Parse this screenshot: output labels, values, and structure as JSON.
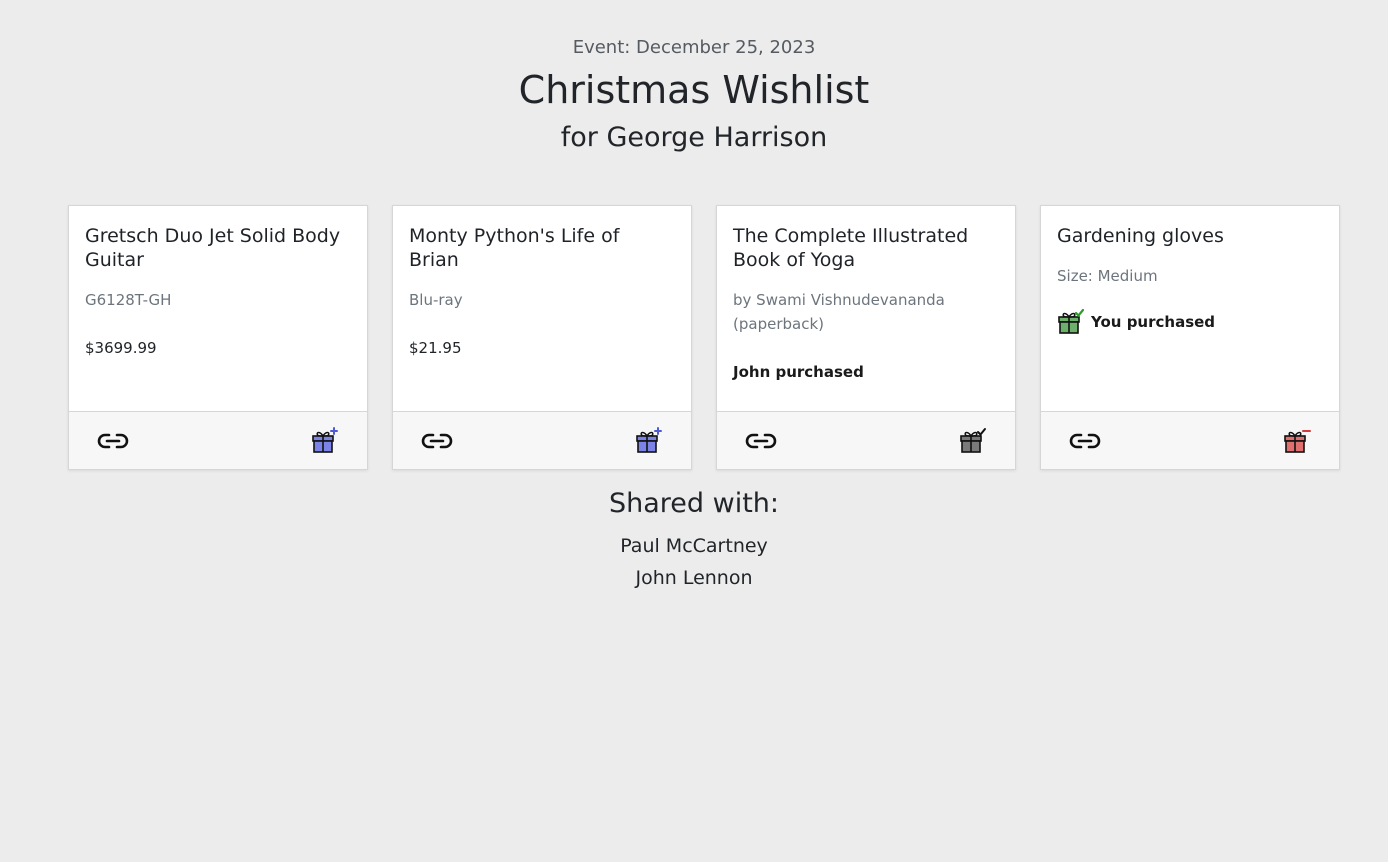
{
  "header": {
    "event_label": "Event: December 25, 2023",
    "title": "Christmas Wishlist",
    "subtitle": "for George Harrison"
  },
  "items": [
    {
      "title": "Gretsch Duo Jet Solid Body Guitar",
      "subtitle": "G6128T-GH",
      "price": "$3699.99",
      "status": "",
      "gift_icon": "gift-add-icon",
      "gift_color": "#7b83e6"
    },
    {
      "title": "Monty Python's Life of Brian",
      "subtitle": "Blu-ray",
      "price": "$21.95",
      "status": "",
      "gift_icon": "gift-add-icon",
      "gift_color": "#7b83e6"
    },
    {
      "title": "The Complete Illustrated Book of Yoga",
      "subtitle": "by Swami Vishnudevananda (paperback)",
      "price": "",
      "status": "John purchased",
      "gift_icon": "gift-purchased-icon",
      "gift_color": "#7a7a7a"
    },
    {
      "title": "Gardening gloves",
      "subtitle": "Size: Medium",
      "price": "",
      "status": "You purchased",
      "gift_icon": "gift-remove-icon",
      "gift_color": "#e07070"
    }
  ],
  "shared": {
    "title": "Shared with:",
    "people": [
      "Paul McCartney",
      "John Lennon"
    ]
  },
  "colors": {
    "background": "#ececec",
    "gift_add": "#7b83e6",
    "gift_purchased_other": "#7a7a7a",
    "gift_purchased_you": "#6cb06c",
    "gift_remove": "#e07070"
  }
}
